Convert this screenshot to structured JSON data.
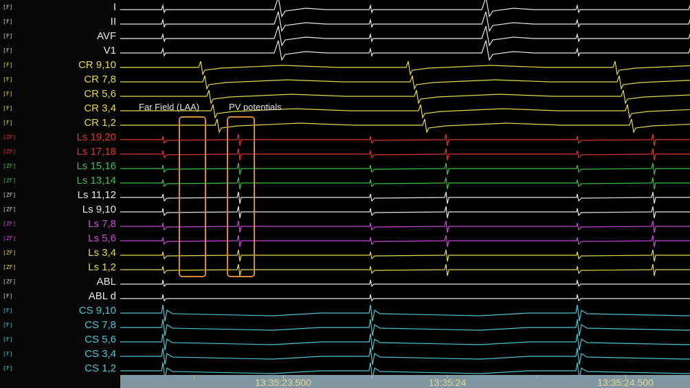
{
  "colors": {
    "background": "#000000",
    "white": "#e8e8e8",
    "yellow": "#e6d94a",
    "red": "#e0362c",
    "green": "#3fbf4a",
    "magenta": "#c84ad8",
    "cyan": "#4fc6d2",
    "annotation_box": "#d98a3a",
    "timebar": "#7f96a3",
    "time_text": "#e8d98a"
  },
  "channels": [
    {
      "filter": "[F]",
      "label": "I",
      "color": "white",
      "group": "surface"
    },
    {
      "filter": "[F]",
      "label": "II",
      "color": "white",
      "group": "surface"
    },
    {
      "filter": "[F]",
      "label": "AVF",
      "color": "white",
      "group": "surface"
    },
    {
      "filter": "[F]",
      "label": "V1",
      "color": "white",
      "group": "surface"
    },
    {
      "filter": "[F]",
      "label": "CR 9,10",
      "color": "yellow",
      "group": "crista"
    },
    {
      "filter": "[F]",
      "label": "CR 7,8",
      "color": "yellow",
      "group": "crista"
    },
    {
      "filter": "[F]",
      "label": "CR 5,6",
      "color": "yellow",
      "group": "crista"
    },
    {
      "filter": "[F]",
      "label": "CR 3,4",
      "color": "yellow",
      "group": "crista"
    },
    {
      "filter": "[F]",
      "label": "CR 1,2",
      "color": "yellow",
      "group": "crista"
    },
    {
      "filter": "[ZF]",
      "label": "Ls 19,20",
      "color": "red",
      "group": "lasso"
    },
    {
      "filter": "[ZF]",
      "label": "Ls 17,18",
      "color": "red",
      "group": "lasso"
    },
    {
      "filter": "[ZF]",
      "label": "Ls 15,16",
      "color": "green",
      "group": "lasso"
    },
    {
      "filter": "[ZF]",
      "label": "Ls 13,14",
      "color": "green",
      "group": "lasso"
    },
    {
      "filter": "[ZF]",
      "label": "Ls 11,12",
      "color": "white",
      "group": "lasso"
    },
    {
      "filter": "[ZF]",
      "label": "Ls 9,10",
      "color": "white",
      "group": "lasso"
    },
    {
      "filter": "[ZF]",
      "label": "Ls 7,8",
      "color": "magenta",
      "group": "lasso"
    },
    {
      "filter": "[ZF]",
      "label": "Ls 5,6",
      "color": "magenta",
      "group": "lasso"
    },
    {
      "filter": "[ZF]",
      "label": "Ls 3,4",
      "color": "yellow",
      "group": "lasso"
    },
    {
      "filter": "[ZF]",
      "label": "Ls 1,2",
      "color": "yellow",
      "group": "lasso"
    },
    {
      "filter": "[ZF]",
      "label": "ABL",
      "color": "white",
      "group": "ablation"
    },
    {
      "filter": "[F]",
      "label": "ABL d",
      "color": "white",
      "group": "ablation"
    },
    {
      "filter": "[F]",
      "label": "CS 9,10",
      "color": "cyan",
      "group": "cs"
    },
    {
      "filter": "[F]",
      "label": "CS 7,8",
      "color": "cyan",
      "group": "cs"
    },
    {
      "filter": "[F]",
      "label": "CS 5,6",
      "color": "cyan",
      "group": "cs"
    },
    {
      "filter": "[F]",
      "label": "CS 3,4",
      "color": "cyan",
      "group": "cs"
    },
    {
      "filter": "[F]",
      "label": "CS 1,2",
      "color": "cyan",
      "group": "cs"
    }
  ],
  "annotations": {
    "far_field": "Far Field (LAA)",
    "pv_potentials": "PV potentials"
  },
  "timebar": {
    "labels": [
      "13:35:23.500",
      "13:35:24",
      "13:35:24.500"
    ]
  }
}
